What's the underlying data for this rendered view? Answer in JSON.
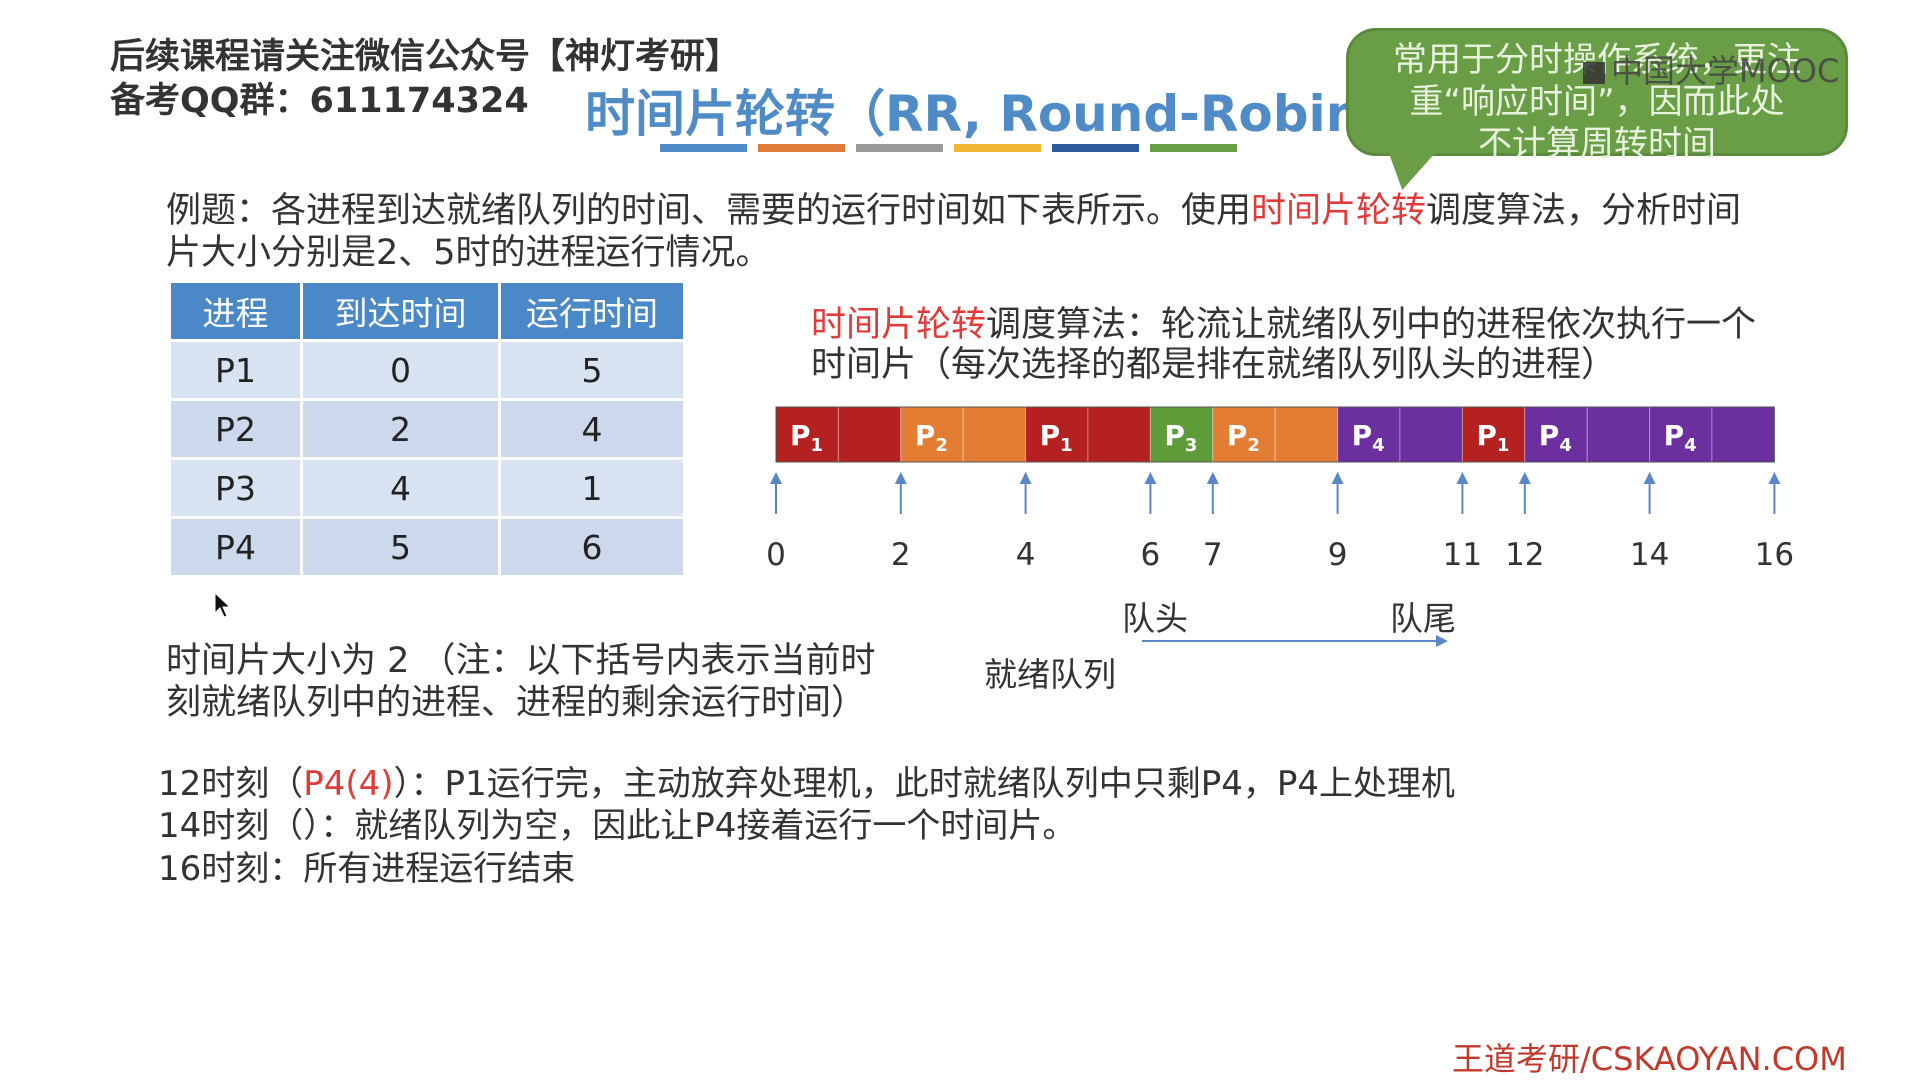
{
  "promo": {
    "line1": "后续课程请关注微信公众号【神灯考研】",
    "line2": "备考QQ群：611174324"
  },
  "slide": {
    "title": "时间片轮转（RR, Round-Robin）",
    "title_bar_colors": [
      "#4f8bc7",
      "#e07b39",
      "#9a9a9a",
      "#f2b632",
      "#2f5a9e",
      "#6a9e46"
    ],
    "bubble_text": [
      "常用于分时操作系统，更注",
      "重“响应时间”，因而此处",
      "不计算周转时间"
    ],
    "watermark": "中国大学MOOC",
    "problem_text_before": "例题：各进程到达就绪队列的时间、需要的运行时间如下表所示。使用",
    "problem_text_highlight": "时间片轮转",
    "problem_text_after": "调度算法，分析时间片大小分别是2、5时的进程运行情况。",
    "algo_highlight": "时间片轮转",
    "algo_text": "调度算法：轮流让就绪队列中的进程依次执行一个时间片（每次选择的都是排在就绪队列队头的进程）",
    "queue_head": "队头",
    "queue_tail": "队尾",
    "queue_label": "就绪队列",
    "slice_note": "时间片大小为 2 （注：以下括号内表示当前时刻就绪队列中的进程、进程的剩余运行时间）",
    "steps": [
      {
        "prefix": "12时刻（",
        "highlight": "P4(4)",
        "suffix": "）：P1运行完，主动放弃处理机，此时就绪队列中只剩P4，P4上处理机"
      },
      {
        "prefix": "14时刻（）：就绪队列为空，因此让P4接着运行一个时间片。",
        "highlight": "",
        "suffix": ""
      },
      {
        "prefix": "16时刻：所有进程运行结束",
        "highlight": "",
        "suffix": ""
      }
    ],
    "footer": "王道考研/CSKAOYAN.COM"
  },
  "table": {
    "headers": [
      "进程",
      "到达时间",
      "运行时间"
    ],
    "rows": [
      [
        "P1",
        "0",
        "5"
      ],
      [
        "P2",
        "2",
        "4"
      ],
      [
        "P3",
        "4",
        "1"
      ],
      [
        "P4",
        "5",
        "6"
      ]
    ]
  },
  "chart_data": {
    "type": "gantt",
    "time_range": [
      0,
      16
    ],
    "tick_labels": [
      0,
      2,
      4,
      6,
      7,
      9,
      11,
      12,
      14,
      16
    ],
    "colors": {
      "P1": "#b52020",
      "P2": "#e47d34",
      "P3": "#5e9c3a",
      "P4": "#6c2fa0"
    },
    "segments": [
      {
        "process": "P1",
        "start": 0,
        "end": 2
      },
      {
        "process": "P2",
        "start": 2,
        "end": 4
      },
      {
        "process": "P1",
        "start": 4,
        "end": 6
      },
      {
        "process": "P3",
        "start": 6,
        "end": 7
      },
      {
        "process": "P2",
        "start": 7,
        "end": 9
      },
      {
        "process": "P4",
        "start": 9,
        "end": 11
      },
      {
        "process": "P1",
        "start": 11,
        "end": 12
      },
      {
        "process": "P4",
        "start": 12,
        "end": 14
      },
      {
        "process": "P4",
        "start": 14,
        "end": 16
      }
    ]
  }
}
